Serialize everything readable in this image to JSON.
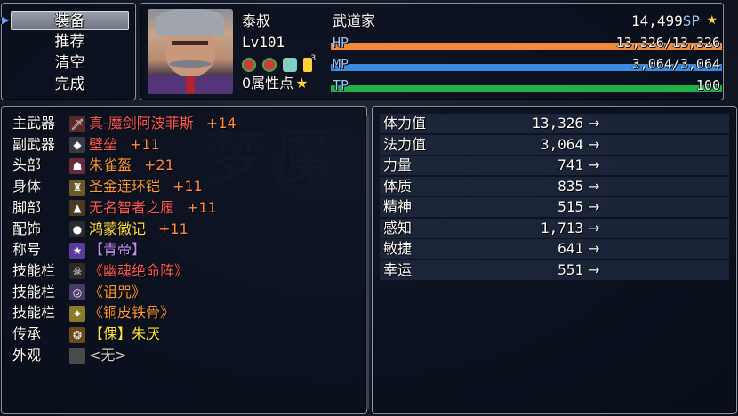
{
  "commands": [
    {
      "label": "装备",
      "selected": true
    },
    {
      "label": "推荐",
      "selected": false
    },
    {
      "label": "清空",
      "selected": false
    },
    {
      "label": "完成",
      "selected": false
    }
  ],
  "actor": {
    "name": "泰叔",
    "class": "武道家",
    "level": "Lv101",
    "sp": "14,499",
    "sp_label": "SP",
    "attr_points": "0属性点",
    "hp_label": "HP",
    "hp": "13,326/13,326",
    "hp_ratio": 1.0,
    "mp_label": "MP",
    "mp": "3,064/3,064",
    "mp_ratio": 1.0,
    "tp_label": "TP",
    "tp": "100",
    "tp_ratio": 1.0,
    "state_counts": [
      "",
      "",
      "",
      "3"
    ]
  },
  "equipment": [
    {
      "slot": "主武器",
      "icon": "sword-icon",
      "name": "真-魔剑阿波菲斯",
      "plus": "+14",
      "color": "#ff5a5a"
    },
    {
      "slot": "副武器",
      "icon": "shield-icon",
      "name": "壁垒",
      "plus": "+11",
      "color": "#ff5a5a"
    },
    {
      "slot": "头部",
      "icon": "helmet-icon",
      "name": "朱雀盔",
      "plus": "+21",
      "color": "#ff9a3a"
    },
    {
      "slot": "身体",
      "icon": "armor-icon",
      "name": "圣金连环铠",
      "plus": "+11",
      "color": "#ff9a3a"
    },
    {
      "slot": "脚部",
      "icon": "boots-icon",
      "name": "无名智者之履",
      "plus": "+11",
      "color": "#ff5a5a"
    },
    {
      "slot": "配饰",
      "icon": "badge-icon",
      "name": "鸿蒙徽记",
      "plus": "+11",
      "color": "#ffe24a"
    },
    {
      "slot": "称号",
      "icon": "title-icon",
      "name": "【青帝】",
      "plus": "",
      "color": "#c58cff"
    },
    {
      "slot": "技能栏",
      "icon": "skull-icon",
      "name": "《幽魂绝命阵》",
      "plus": "",
      "color": "#ff5a5a"
    },
    {
      "slot": "技能栏",
      "icon": "curse-icon",
      "name": "《诅咒》",
      "plus": "",
      "color": "#ff9a3a"
    },
    {
      "slot": "技能栏",
      "icon": "body-icon",
      "name": "《铜皮铁骨》",
      "plus": "",
      "color": "#ff9a3a"
    },
    {
      "slot": "传承",
      "icon": "inherit-icon",
      "name": "【倮】朱厌",
      "plus": "",
      "color": "#ffe24a"
    },
    {
      "slot": "外观",
      "icon": "empty-icon",
      "name": "<无>",
      "plus": "",
      "color": "#d0d0d0"
    }
  ],
  "params": [
    {
      "name": "体力值",
      "value": "13,326",
      "arrow": "→"
    },
    {
      "name": "法力值",
      "value": "3,064",
      "arrow": "→"
    },
    {
      "name": "力量",
      "value": "741",
      "arrow": "→"
    },
    {
      "name": "体质",
      "value": "835",
      "arrow": "→"
    },
    {
      "name": "精神",
      "value": "515",
      "arrow": "→"
    },
    {
      "name": "感知",
      "value": "1,713",
      "arrow": "→"
    },
    {
      "name": "敏捷",
      "value": "641",
      "arrow": "→"
    },
    {
      "name": "幸运",
      "value": "551",
      "arrow": "→"
    }
  ],
  "colors": {
    "hp_bar": "#f08a3a",
    "mp_bar": "#3a8ae0",
    "tp_bar": "#22b04a",
    "accent_blue": "#9cc7ff"
  }
}
